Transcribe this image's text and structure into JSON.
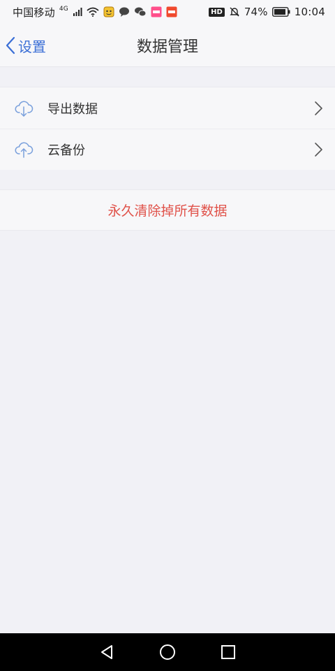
{
  "status_bar": {
    "carrier": "中国移动",
    "network": "4G",
    "battery_percent": "74%",
    "time": "10:04",
    "hd_label": "HD"
  },
  "nav": {
    "back_label": "设置",
    "title": "数据管理"
  },
  "list": {
    "items": [
      {
        "label": "导出数据",
        "icon": "cloud-download-icon"
      },
      {
        "label": "云备份",
        "icon": "cloud-upload-icon"
      }
    ]
  },
  "danger": {
    "label": "永久清除掉所有数据"
  },
  "colors": {
    "accent": "#3b6fd6",
    "danger": "#e0524a",
    "background": "#f1f1f6",
    "surface": "#f7f7f9"
  }
}
